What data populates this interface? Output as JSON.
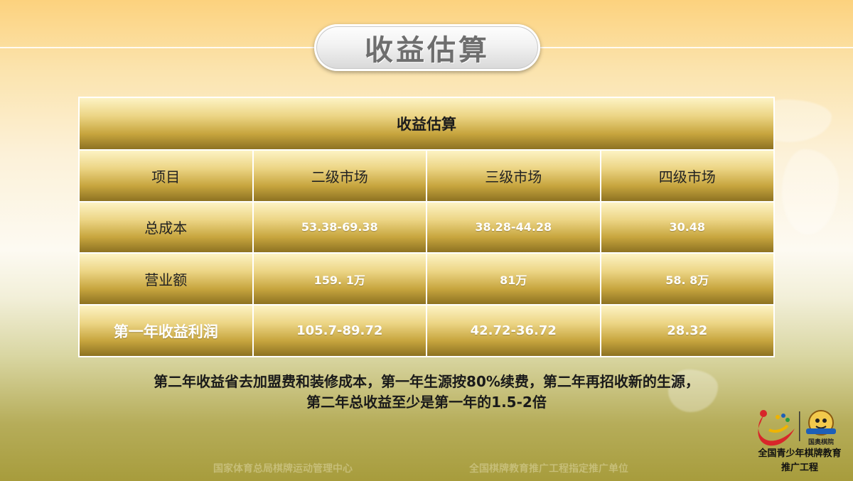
{
  "slide": {
    "title": "收益估算"
  },
  "table": {
    "title": "收益估算",
    "headers": [
      "项目",
      "二级市场",
      "三级市场",
      "四级市场"
    ],
    "rows": [
      {
        "label": "总成本",
        "values": [
          "53.38-69.38",
          "38.28-44.28",
          "30.48"
        ]
      },
      {
        "label": "营业额",
        "values": [
          "159. 1万",
          "81万",
          "58. 8万"
        ]
      },
      {
        "label": "第一年收益利润",
        "values": [
          "105.7-89.72",
          "42.72-36.72",
          "28.32"
        ]
      }
    ]
  },
  "note": {
    "line1": "第二年收益省去加盟费和装修成本，第一年生源按80%续费，第二年再招收新的生源，",
    "line2": "第二年总收益至少是第一年的1.5-2倍"
  },
  "footer": {
    "left": "国家体育总局棋牌运动管理中心",
    "right": "全国棋牌教育推广工程指定推广单位"
  },
  "logo": {
    "badge_text": "国奥棋院",
    "caption_line1": "全国青少年棋牌教育",
    "caption_line2": "推广工程"
  },
  "colors": {
    "cell_gold_top": "#fdf3c4",
    "cell_gold_bottom": "#8d7222",
    "title_gray": "#6e6e6e"
  }
}
